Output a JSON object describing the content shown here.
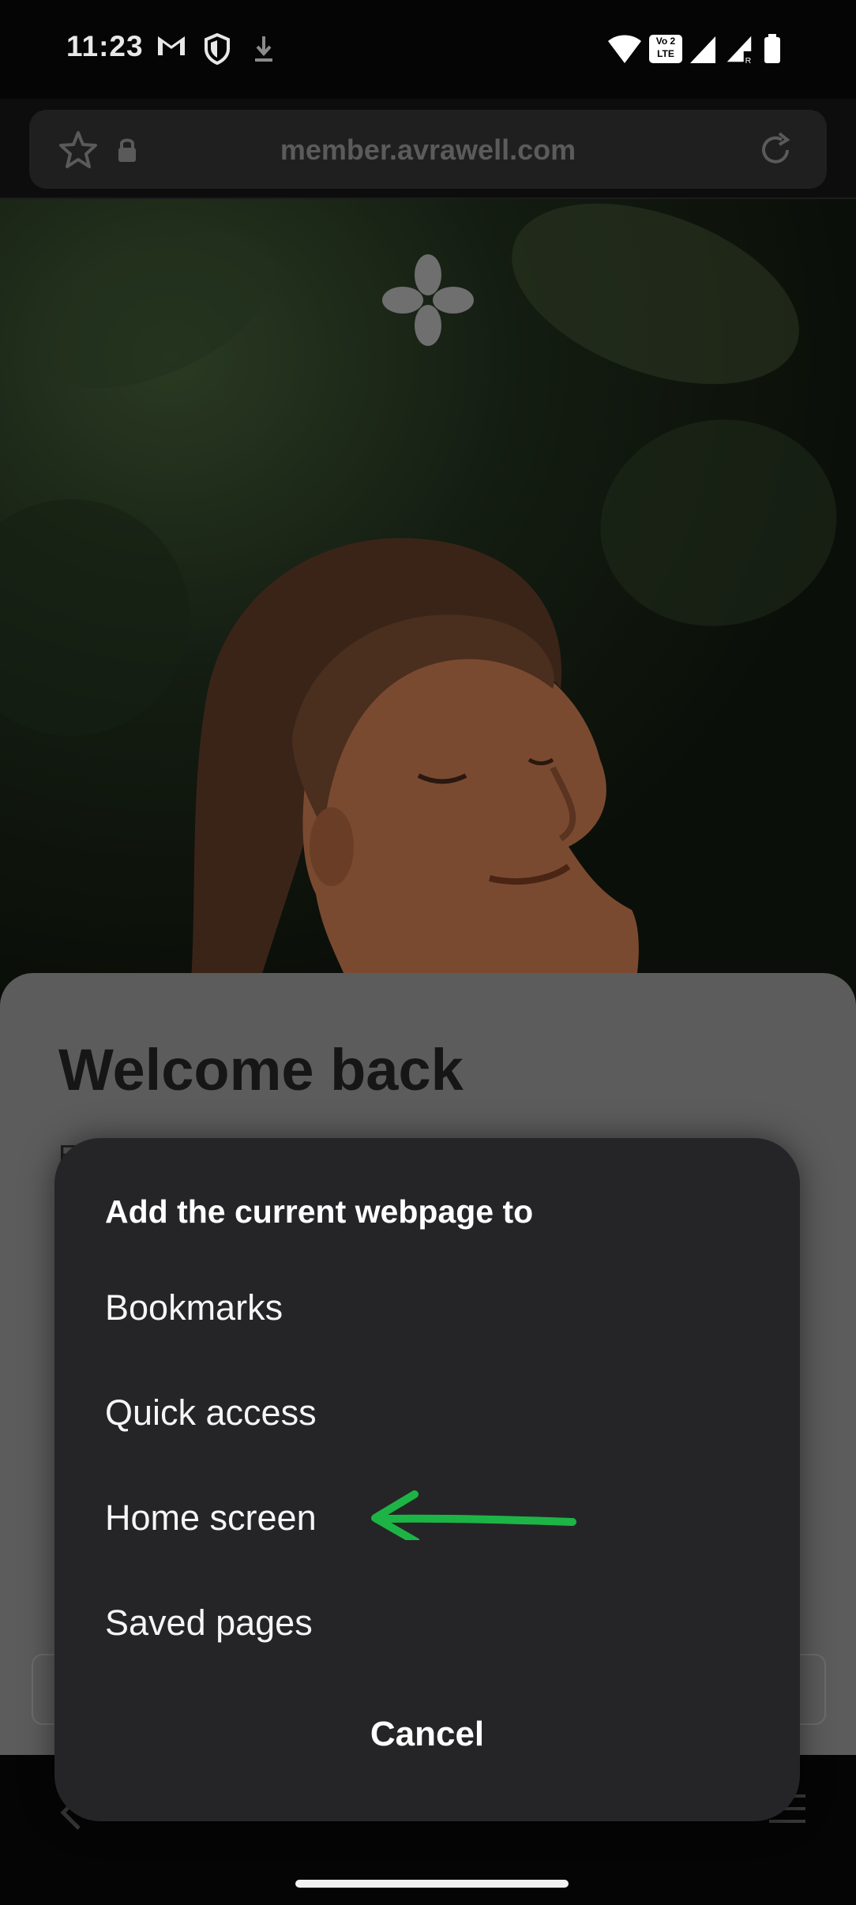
{
  "status_bar": {
    "time": "11:23",
    "icons_left": [
      "gmail-icon",
      "shield-icon",
      "download-icon"
    ],
    "icons_right": [
      "wifi-icon",
      "volte-icon",
      "signal-icon",
      "signal-roaming-icon",
      "battery-icon"
    ],
    "volte_label_top": "Vo 2",
    "volte_label_bottom": "LTE"
  },
  "browser": {
    "url": "member.avrawell.com"
  },
  "page": {
    "welcome_title": "Welcome back",
    "partial_text": "E"
  },
  "dialog": {
    "title": "Add the current webpage to",
    "options": [
      "Bookmarks",
      "Quick access",
      "Home screen",
      "Saved pages"
    ],
    "cancel_label": "Cancel"
  },
  "annotation": {
    "arrow_color": "#1db446",
    "points_to": "Home screen"
  }
}
